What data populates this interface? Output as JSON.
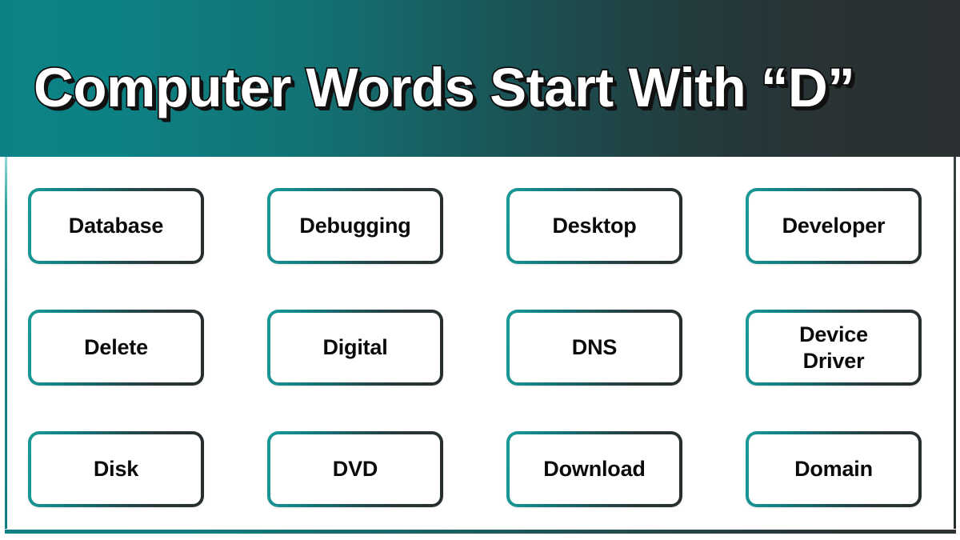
{
  "header": {
    "title": "Computer Words Start With “D”",
    "gradient_start_color": "#0b8386",
    "gradient_end_color": "#2b3133",
    "title_color": "#ffffff",
    "title_outline_color": "#0d0d0d"
  },
  "content": {
    "background_color": "#ffffff",
    "left_edge_color": "#0e7f82",
    "right_edge_color": "#2c3234",
    "bottom_edge_gradient_start": "#0d8184",
    "bottom_edge_gradient_end": "#2b3133"
  },
  "grid": {
    "rows": 3,
    "columns": 4,
    "card_border_gradient_start": "#1b9a98",
    "card_border_gradient_end": "#272d2f",
    "card_text_color": "#0a0a0a",
    "cards": [
      {
        "label": "Database"
      },
      {
        "label": "Debugging"
      },
      {
        "label": "Desktop"
      },
      {
        "label": "Developer"
      },
      {
        "label": "Delete"
      },
      {
        "label": "Digital"
      },
      {
        "label": "DNS"
      },
      {
        "label": "Device\nDriver"
      },
      {
        "label": "Disk"
      },
      {
        "label": "DVD"
      },
      {
        "label": "Download"
      },
      {
        "label": "Domain"
      }
    ]
  }
}
